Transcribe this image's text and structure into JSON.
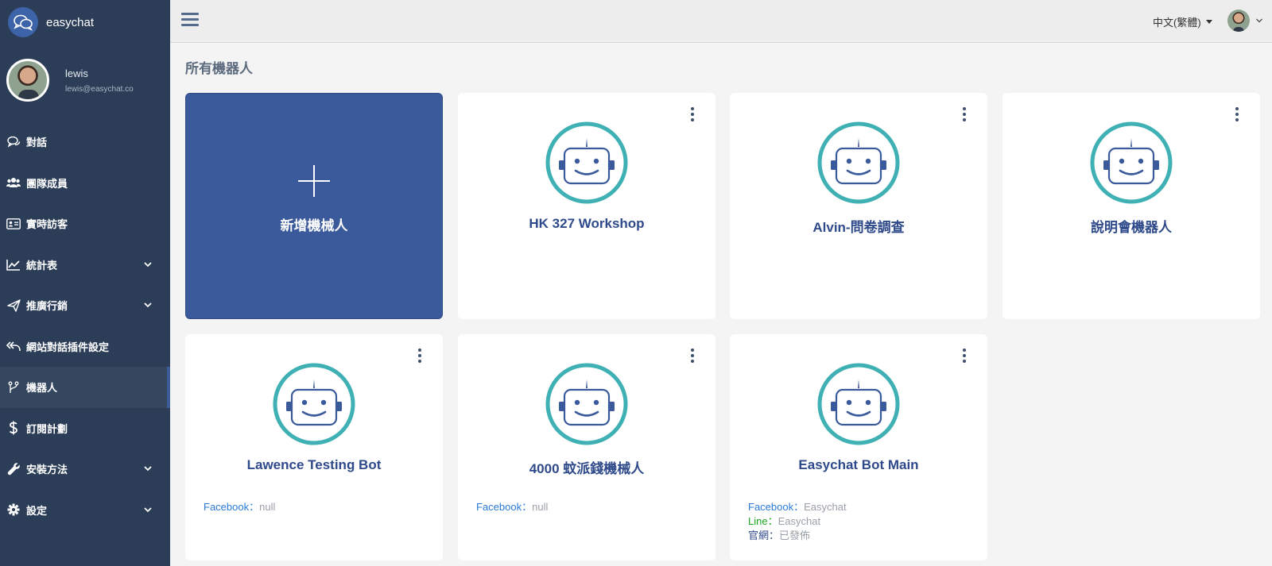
{
  "app": {
    "brand_name": "easychat",
    "logo_icon": "chat-bubbles-icon"
  },
  "user": {
    "name": "lewis",
    "email": "lewis@easychat.co"
  },
  "sidebar": {
    "items": [
      {
        "label": "對話",
        "icon": "chat-icon",
        "has_dropdown": false
      },
      {
        "label": "團隊成員",
        "icon": "team-icon",
        "has_dropdown": false
      },
      {
        "label": "實時訪客",
        "icon": "id-card-icon",
        "has_dropdown": false
      },
      {
        "label": "統計表",
        "icon": "line-chart-icon",
        "has_dropdown": true
      },
      {
        "label": "推廣行銷",
        "icon": "paper-plane-icon",
        "has_dropdown": true
      },
      {
        "label": "網站對話插件設定",
        "icon": "reply-all-icon",
        "has_dropdown": false
      },
      {
        "label": "機器人",
        "icon": "branch-icon",
        "has_dropdown": false,
        "active": true
      },
      {
        "label": "訂閱計劃",
        "icon": "dollar-icon",
        "has_dropdown": false
      },
      {
        "label": "安裝方法",
        "icon": "wrench-icon",
        "has_dropdown": true
      },
      {
        "label": "設定",
        "icon": "gear-icon",
        "has_dropdown": true
      }
    ]
  },
  "topbar": {
    "language": "中文(繁體)"
  },
  "main": {
    "title": "所有機器人",
    "add_card_label": "新增機械人",
    "bots": [
      {
        "name": "HK 327 Workshop",
        "channels": []
      },
      {
        "name": "Alvin-問卷調查",
        "channels": []
      },
      {
        "name": "說明會機器人",
        "channels": []
      },
      {
        "name": "Lawence Testing Bot",
        "channels": [
          {
            "label": "Facebook",
            "value": "null"
          }
        ]
      },
      {
        "name": "4000 蚊派錢機械人",
        "channels": [
          {
            "label": "Facebook",
            "value": "null"
          }
        ]
      },
      {
        "name": "Easychat Bot Main",
        "channels": [
          {
            "label": "Facebook",
            "value": "Easychat"
          },
          {
            "label": "Line",
            "value": "Easychat"
          },
          {
            "label": "官網",
            "value": "已發佈"
          }
        ]
      }
    ],
    "channel_separator": "："
  },
  "colors": {
    "sidebar_bg": "#2b3d57",
    "accent_blue": "#3b5a9b",
    "bot_ring_teal": "#3fb0b3",
    "facebook_link": "#2b7bd8",
    "line_link": "#1fa61f"
  }
}
